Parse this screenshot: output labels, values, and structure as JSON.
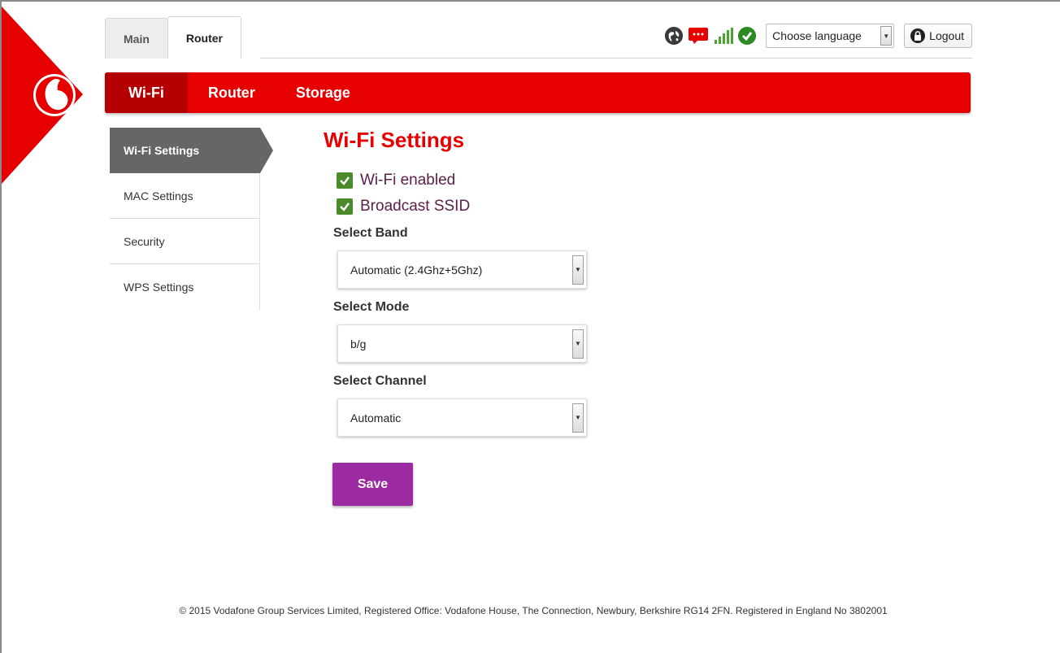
{
  "top_tabs": [
    {
      "label": "Main",
      "active": false
    },
    {
      "label": "Router",
      "active": true
    }
  ],
  "status": {
    "icons": [
      "globe-icon",
      "message-icon",
      "signal-icon",
      "connected-check-icon"
    ],
    "language_select": "Choose language",
    "logout_label": "Logout"
  },
  "red_nav": [
    {
      "label": "Wi-Fi",
      "active": true
    },
    {
      "label": "Router",
      "active": false
    },
    {
      "label": "Storage",
      "active": false
    }
  ],
  "sidebar": [
    {
      "label": "Wi-Fi Settings",
      "active": true
    },
    {
      "label": "MAC Settings",
      "active": false
    },
    {
      "label": "Security",
      "active": false
    },
    {
      "label": "WPS Settings",
      "active": false
    }
  ],
  "main": {
    "title": "Wi-Fi Settings",
    "checkboxes": [
      {
        "label": "Wi-Fi enabled",
        "checked": true
      },
      {
        "label": "Broadcast SSID",
        "checked": true
      }
    ],
    "band": {
      "label": "Select Band",
      "value": "Automatic (2.4Ghz+5Ghz)"
    },
    "mode": {
      "label": "Select Mode",
      "value": "b/g"
    },
    "channel": {
      "label": "Select Channel",
      "value": "Automatic"
    },
    "save_label": "Save"
  },
  "footer": "© 2015 Vodafone Group Services Limited, Registered Office: Vodafone House, The Connection, Newbury, Berkshire RG14 2FN. Registered in England No 3802001",
  "colors": {
    "brand_red": "#e60000",
    "active_nav_red": "#b40000",
    "sidebar_active": "#666666",
    "save_purple": "#9c2aa0",
    "check_green": "#4a8a2a"
  }
}
